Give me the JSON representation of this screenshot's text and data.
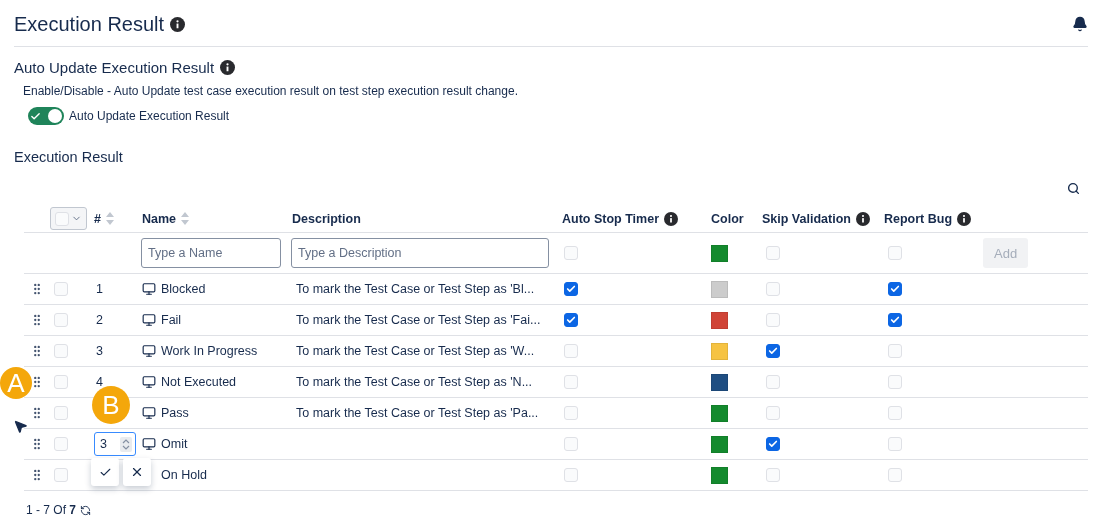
{
  "header": {
    "title": "Execution Result"
  },
  "auto_update": {
    "heading": "Auto Update Execution Result",
    "description": "Enable/Disable - Auto Update test case execution result on test step execution result change.",
    "toggle": {
      "label": "Auto Update Execution Result",
      "on": true
    }
  },
  "table_section": {
    "heading": "Execution Result"
  },
  "table": {
    "select_all": {
      "checked": false
    },
    "columns": [
      {
        "label": "#",
        "sortable": true,
        "info": false
      },
      {
        "label": "Name",
        "sortable": true,
        "info": false
      },
      {
        "label": "Description",
        "sortable": false,
        "info": false
      },
      {
        "label": "Auto Stop Timer",
        "sortable": false,
        "info": true
      },
      {
        "label": "Color",
        "sortable": false,
        "info": false
      },
      {
        "label": "Skip Validation",
        "sortable": false,
        "info": true
      },
      {
        "label": "Report Bug",
        "sortable": false,
        "info": true
      }
    ],
    "new_row": {
      "name_placeholder": "Type a Name",
      "description_placeholder": "Type a Description",
      "auto_stop_timer": false,
      "color": "#148a2e",
      "skip_validation": false,
      "report_bug": false,
      "add_label": "Add",
      "add_disabled": true
    },
    "rows": [
      {
        "number": "1",
        "name": "Blocked",
        "description": "To mark the Test Case or Test Step as 'Bl...",
        "auto_stop_timer": true,
        "color": "#cccccc",
        "skip_validation": false,
        "report_bug": true,
        "selected": false,
        "kind": "view"
      },
      {
        "number": "2",
        "name": "Fail",
        "description": "To mark the Test Case or Test Step as 'Fai...",
        "auto_stop_timer": true,
        "color": "#d04437",
        "skip_validation": false,
        "report_bug": true,
        "selected": false,
        "kind": "view"
      },
      {
        "number": "3",
        "name": "Work In Progress",
        "description": "To mark the Test Case or Test Step as 'W...",
        "auto_stop_timer": false,
        "color": "#f6c342",
        "skip_validation": true,
        "report_bug": false,
        "selected": false,
        "kind": "view"
      },
      {
        "number": "4",
        "name": "Not Executed",
        "description": "To mark the Test Case or Test Step as 'N...",
        "auto_stop_timer": false,
        "color": "#1f4e82",
        "skip_validation": false,
        "report_bug": false,
        "selected": false,
        "kind": "view"
      },
      {
        "name": "Pass",
        "description": "To mark the Test Case or Test Step as 'Pa...",
        "auto_stop_timer": false,
        "color": "#148a2e",
        "skip_validation": false,
        "report_bug": false,
        "selected": false,
        "kind": "view"
      },
      {
        "number": "3",
        "name": "Omit",
        "auto_stop_timer": false,
        "color": "#148a2e",
        "skip_validation": true,
        "report_bug": false,
        "selected": false,
        "kind": "edit"
      },
      {
        "name": "On Hold",
        "has_icon": false,
        "auto_stop_timer": false,
        "color": "#148a2e",
        "skip_validation": false,
        "report_bug": false,
        "selected": false,
        "kind": "view"
      }
    ]
  },
  "pagination": {
    "summary": "1 - 7 Of **7**"
  },
  "annotations": [
    {
      "label": "A"
    },
    {
      "label": "B"
    }
  ]
}
